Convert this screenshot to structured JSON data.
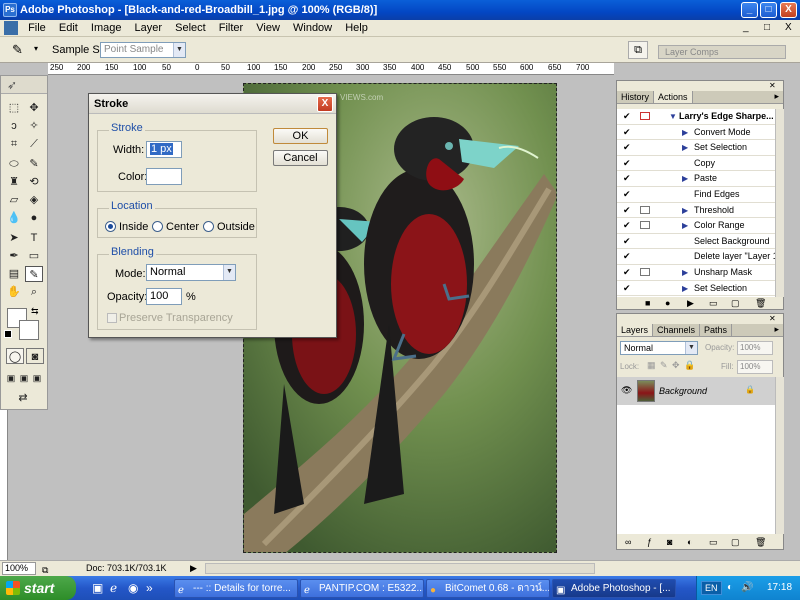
{
  "window": {
    "title": "Adobe Photoshop - [Black-and-red-Broadbill_1.jpg @ 100% (RGB/8)]",
    "min": "_",
    "max": "□",
    "close": "X"
  },
  "doc_window": {
    "min": "_",
    "max": "□",
    "close": "X"
  },
  "menu": [
    "File",
    "Edit",
    "Image",
    "Layer",
    "Select",
    "Filter",
    "View",
    "Window",
    "Help"
  ],
  "options": {
    "sample_size_label": "Sample Size:",
    "sample_size_value": "Point Sample",
    "layer_comps_tab": "Layer Comps"
  },
  "ruler_ticks": [
    "250",
    "200",
    "150",
    "100",
    "50",
    "0",
    "50",
    "100",
    "150",
    "200",
    "250",
    "300",
    "350",
    "400",
    "450",
    "500",
    "550",
    "600",
    "650",
    "700"
  ],
  "watermark": "VIEWS.com",
  "stroke_dialog": {
    "title": "Stroke",
    "close": "X",
    "stroke_group": "Stroke",
    "width_label": "Width:",
    "width_value": "1 px",
    "color_label": "Color:",
    "color_swatch": "#ffffff",
    "location_group": "Location",
    "location_options": [
      "Inside",
      "Center",
      "Outside"
    ],
    "location_selected": "Inside",
    "blending_group": "Blending",
    "mode_label": "Mode:",
    "mode_value": "Normal",
    "opacity_label": "Opacity:",
    "opacity_value": "100",
    "opacity_unit": "%",
    "preserve_label": "Preserve Transparency",
    "ok_label": "OK",
    "cancel_label": "Cancel"
  },
  "actions_panel": {
    "tabs": [
      "History",
      "Actions"
    ],
    "active_tab": "Actions",
    "set_name": "Larry's Edge Sharpe...",
    "items": [
      "Convert Mode",
      "Set Selection",
      "Copy",
      "Paste",
      "Find Edges",
      "Threshold",
      "Color Range",
      "Select Background",
      "Delete layer \"Layer 1\"",
      "Unsharp Mask",
      "Set Selection"
    ]
  },
  "layers_panel": {
    "tabs": [
      "Layers",
      "Channels",
      "Paths"
    ],
    "active_tab": "Layers",
    "blend_mode": "Normal",
    "opacity_label": "Opacity:",
    "opacity_value": "100%",
    "lock_label": "Lock:",
    "fill_label": "Fill:",
    "fill_value": "100%",
    "layer_name": "Background"
  },
  "status": {
    "zoom": "100%",
    "doc_info": "Doc: 703.1K/703.1K"
  },
  "taskbar": {
    "start": "start",
    "tasks": [
      "--- :: Details for torre...",
      "PANTIP.COM : E5322...",
      "BitComet 0.68 - ดาวน์...",
      "Adobe Photoshop - [..."
    ],
    "lang": "EN",
    "time": "17:18"
  },
  "colors": {
    "xp_blue": "#0347c4",
    "panel_bg": "#ece9d8",
    "group_label": "#1f4fa8"
  }
}
